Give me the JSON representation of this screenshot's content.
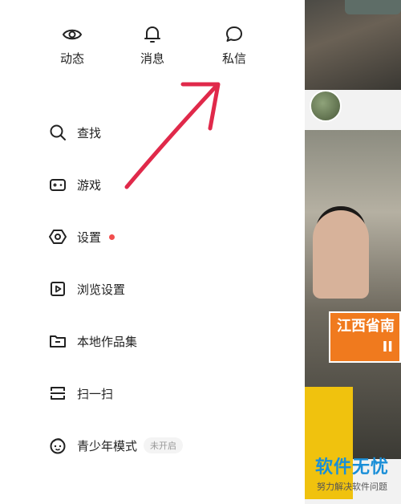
{
  "top_nav": {
    "items": [
      {
        "label": "动态",
        "icon": "eye-icon"
      },
      {
        "label": "消息",
        "icon": "bell-icon"
      },
      {
        "label": "私信",
        "icon": "chat-bubble-icon"
      }
    ]
  },
  "menu": {
    "items": [
      {
        "label": "查找",
        "icon": "search-icon"
      },
      {
        "label": "游戏",
        "icon": "gamepad-icon"
      },
      {
        "label": "设置",
        "icon": "hexagon-settings-icon",
        "has_notification_dot": true
      },
      {
        "label": "浏览设置",
        "icon": "play-square-icon"
      },
      {
        "label": "本地作品集",
        "icon": "folder-icon"
      },
      {
        "label": "扫一扫",
        "icon": "scan-icon"
      },
      {
        "label": "青少年模式",
        "icon": "teen-mode-icon",
        "badge": "未开启"
      }
    ]
  },
  "feed": {
    "banner_lines": [
      "江西省南",
      "II"
    ]
  },
  "watermark": {
    "title": "软件无忧",
    "subtitle": "努力解决软件问题"
  },
  "colors": {
    "notification_dot": "#f24d4d",
    "annotation_arrow": "#e0294a",
    "banner": "#f07a1e",
    "watermark_blue": "#1a8fd8"
  }
}
